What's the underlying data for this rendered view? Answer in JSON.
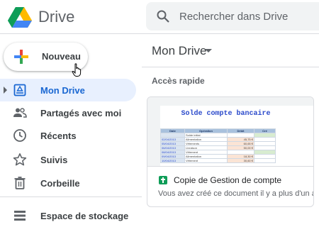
{
  "header": {
    "brand": "Drive",
    "search_placeholder": "Rechercher dans Drive"
  },
  "sidebar": {
    "new_label": "Nouveau",
    "items": [
      {
        "label": "Mon Drive",
        "icon": "drive-icon",
        "active": true
      },
      {
        "label": "Partagés avec moi",
        "icon": "people-icon"
      },
      {
        "label": "Récents",
        "icon": "clock-icon"
      },
      {
        "label": "Suivis",
        "icon": "star-icon"
      },
      {
        "label": "Corbeille",
        "icon": "trash-icon"
      }
    ],
    "storage_label": "Espace de stockage"
  },
  "main": {
    "title": "Mon Drive",
    "quick_access_title": "Accès rapide",
    "card": {
      "file_name": "Copie de Gestion de compte",
      "subtitle": "Vous avez créé ce document il y a plus d'un an",
      "preview": {
        "title": "Solde compte bancaire",
        "headers": [
          "Date",
          "Opération",
          "Débit",
          "Cré"
        ],
        "rows": [
          [
            "",
            "Solde initial",
            "",
            ""
          ],
          [
            "02/04/2013",
            "Alimentation",
            "45,75 €",
            ""
          ],
          [
            "05/04/2013",
            "Vêtements",
            "60,65 €",
            ""
          ],
          [
            "06/04/2013",
            "Livraison",
            "50,00 €",
            ""
          ],
          [
            "08/04/2013",
            "Vêtement",
            "",
            ""
          ],
          [
            "09/04/2013",
            "Alimentation",
            "18,30 €",
            ""
          ],
          [
            "10/04/2013",
            "Vêtement",
            "30,60 €",
            ""
          ]
        ]
      }
    }
  },
  "colors": {
    "accent": "#1967d2",
    "active_bg": "#e8f0fe",
    "sheets_green": "#0f9d58"
  }
}
